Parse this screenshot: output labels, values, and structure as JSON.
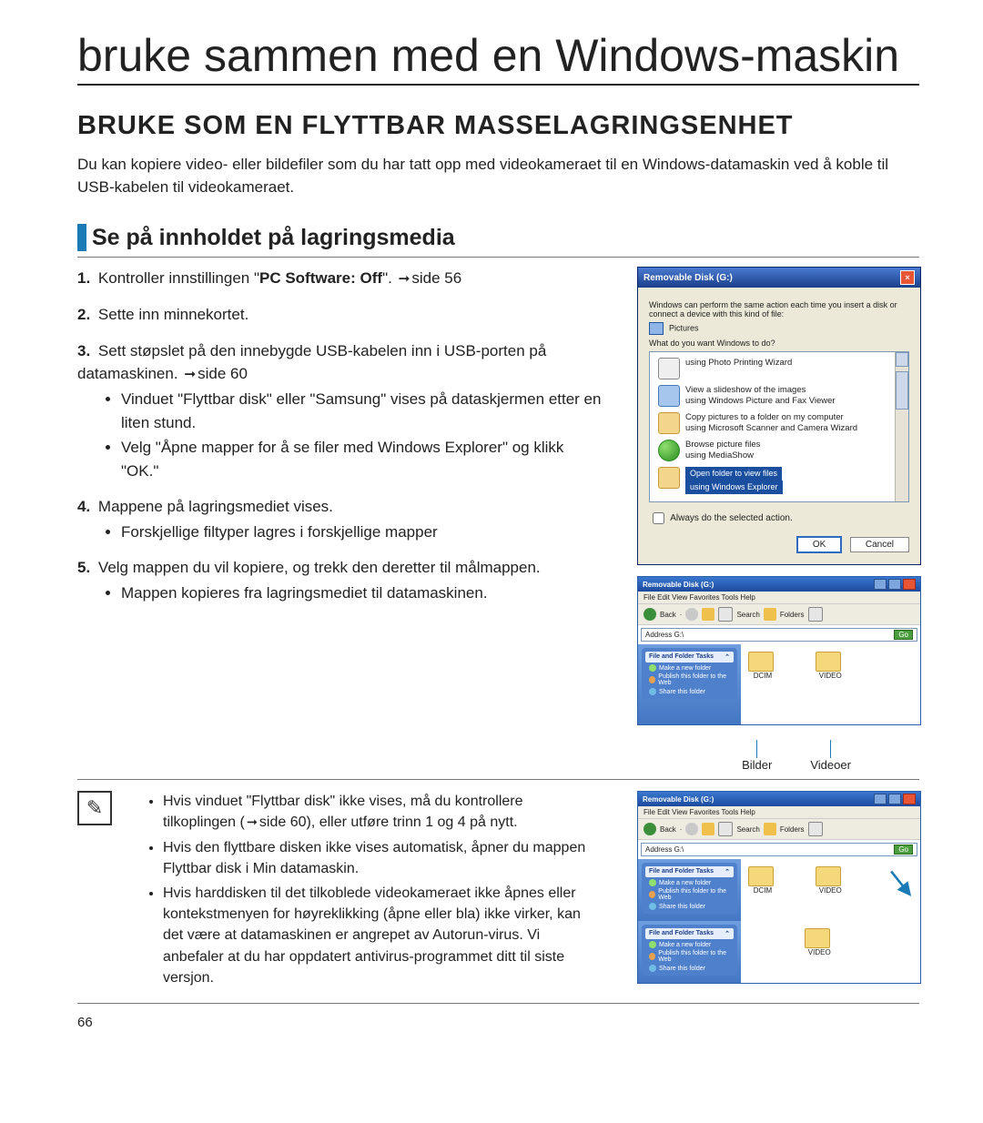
{
  "hero": "bruke sammen med en Windows-maskin",
  "section_title": "BRUKE SOM EN FLYTTBAR MASSELAGRINGSENHET",
  "intro": "Du kan kopiere video- eller bildefiler som du har tatt opp med videokameraet til en Windows-datamaskin ved å koble til USB-kabelen til videokameraet.",
  "subheading": "Se på innholdet på lagringsmedia",
  "steps": {
    "s1_pre": "Kontroller innstillingen \"",
    "s1_bold": "PC Software: Off",
    "s1_post": "\". ",
    "s1_page": "side 56",
    "s2": "Sette inn minnekortet.",
    "s3a": "Sett støpslet på den innebygde USB-kabelen inn i USB-porten på datamaskinen. ",
    "s3a_page": "side 60",
    "s3b1": "Vinduet \"Flyttbar disk\" eller \"Samsung\" vises på dataskjermen etter en liten stund.",
    "s3b2": "Velg \"Åpne mapper for å se filer med Windows Explorer\" og klikk \"OK.\"",
    "s4a": "Mappene på lagringsmediet vises.",
    "s4b1": "Forskjellige filtyper lagres i forskjellige mapper",
    "s5a": "Velg mappen du vil kopiere, og trekk den deretter til målmappen.",
    "s5b1": "Mappen kopieres fra lagringsmediet til datamaskinen."
  },
  "dialog": {
    "title": "Removable Disk (G:)",
    "line1": "Windows can perform the same action each time you insert a disk or connect a device with this kind of file:",
    "pictures": "Pictures",
    "line2": "What do you want Windows to do?",
    "opt1": "using Photo Printing Wizard",
    "opt2a": "View a slideshow of the images",
    "opt2b": "using Windows Picture and Fax Viewer",
    "opt3a": "Copy pictures to a folder on my computer",
    "opt3b": "using Microsoft Scanner and Camera Wizard",
    "opt4a": "Browse picture files",
    "opt4b": "using MediaShow",
    "sel1": "Open folder to view files",
    "sel2": "using Windows Explorer",
    "check": "Always do the selected action.",
    "ok": "OK",
    "cancel": "Cancel"
  },
  "explorer1": {
    "title": "Removable Disk (G:)",
    "menu": "File   Edit   View   Favorites   Tools   Help",
    "back": "Back",
    "search": "Search",
    "folders": "Folders",
    "address": "Address  G:\\",
    "go": "Go",
    "panel_head": "File and Folder Tasks",
    "pli1": "Make a new folder",
    "pli2": "Publish this folder to the Web",
    "pli3": "Share this folder",
    "fold1": "DCIM",
    "fold2": "VIDEO"
  },
  "caption1": "Bilder",
  "caption2": "Videoer",
  "explorer2": {
    "title": "Removable Disk (G:)",
    "fold1": "DCIM",
    "fold2": "VIDEO",
    "fold3": "VIDEO",
    "panel2_head": "File and Folder Tasks"
  },
  "notes": {
    "n1a": "Hvis vinduet \"Flyttbar disk\" ikke vises, må du kontrollere tilkoplingen (",
    "n1b": "side 60), eller utføre trinn 1 og 4 på nytt.",
    "n2": "Hvis den flyttbare disken ikke vises automatisk, åpner du mappen Flyttbar disk i Min datamaskin.",
    "n3": "Hvis harddisken til det tilkoblede videokameraet ikke åpnes eller kontekstmenyen for høyreklikking (åpne eller bla) ikke virker, kan det være at datamaskinen er angrepet av Autorun-virus. Vi anbefaler at du har oppdatert antivirus-programmet ditt til siste versjon."
  },
  "page_no": "66"
}
